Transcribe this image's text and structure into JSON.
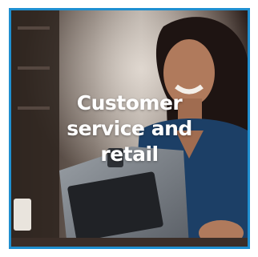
{
  "tile": {
    "title_lines": [
      "Customer",
      "service and",
      "retail"
    ],
    "border_color": "#1f8fd0"
  }
}
